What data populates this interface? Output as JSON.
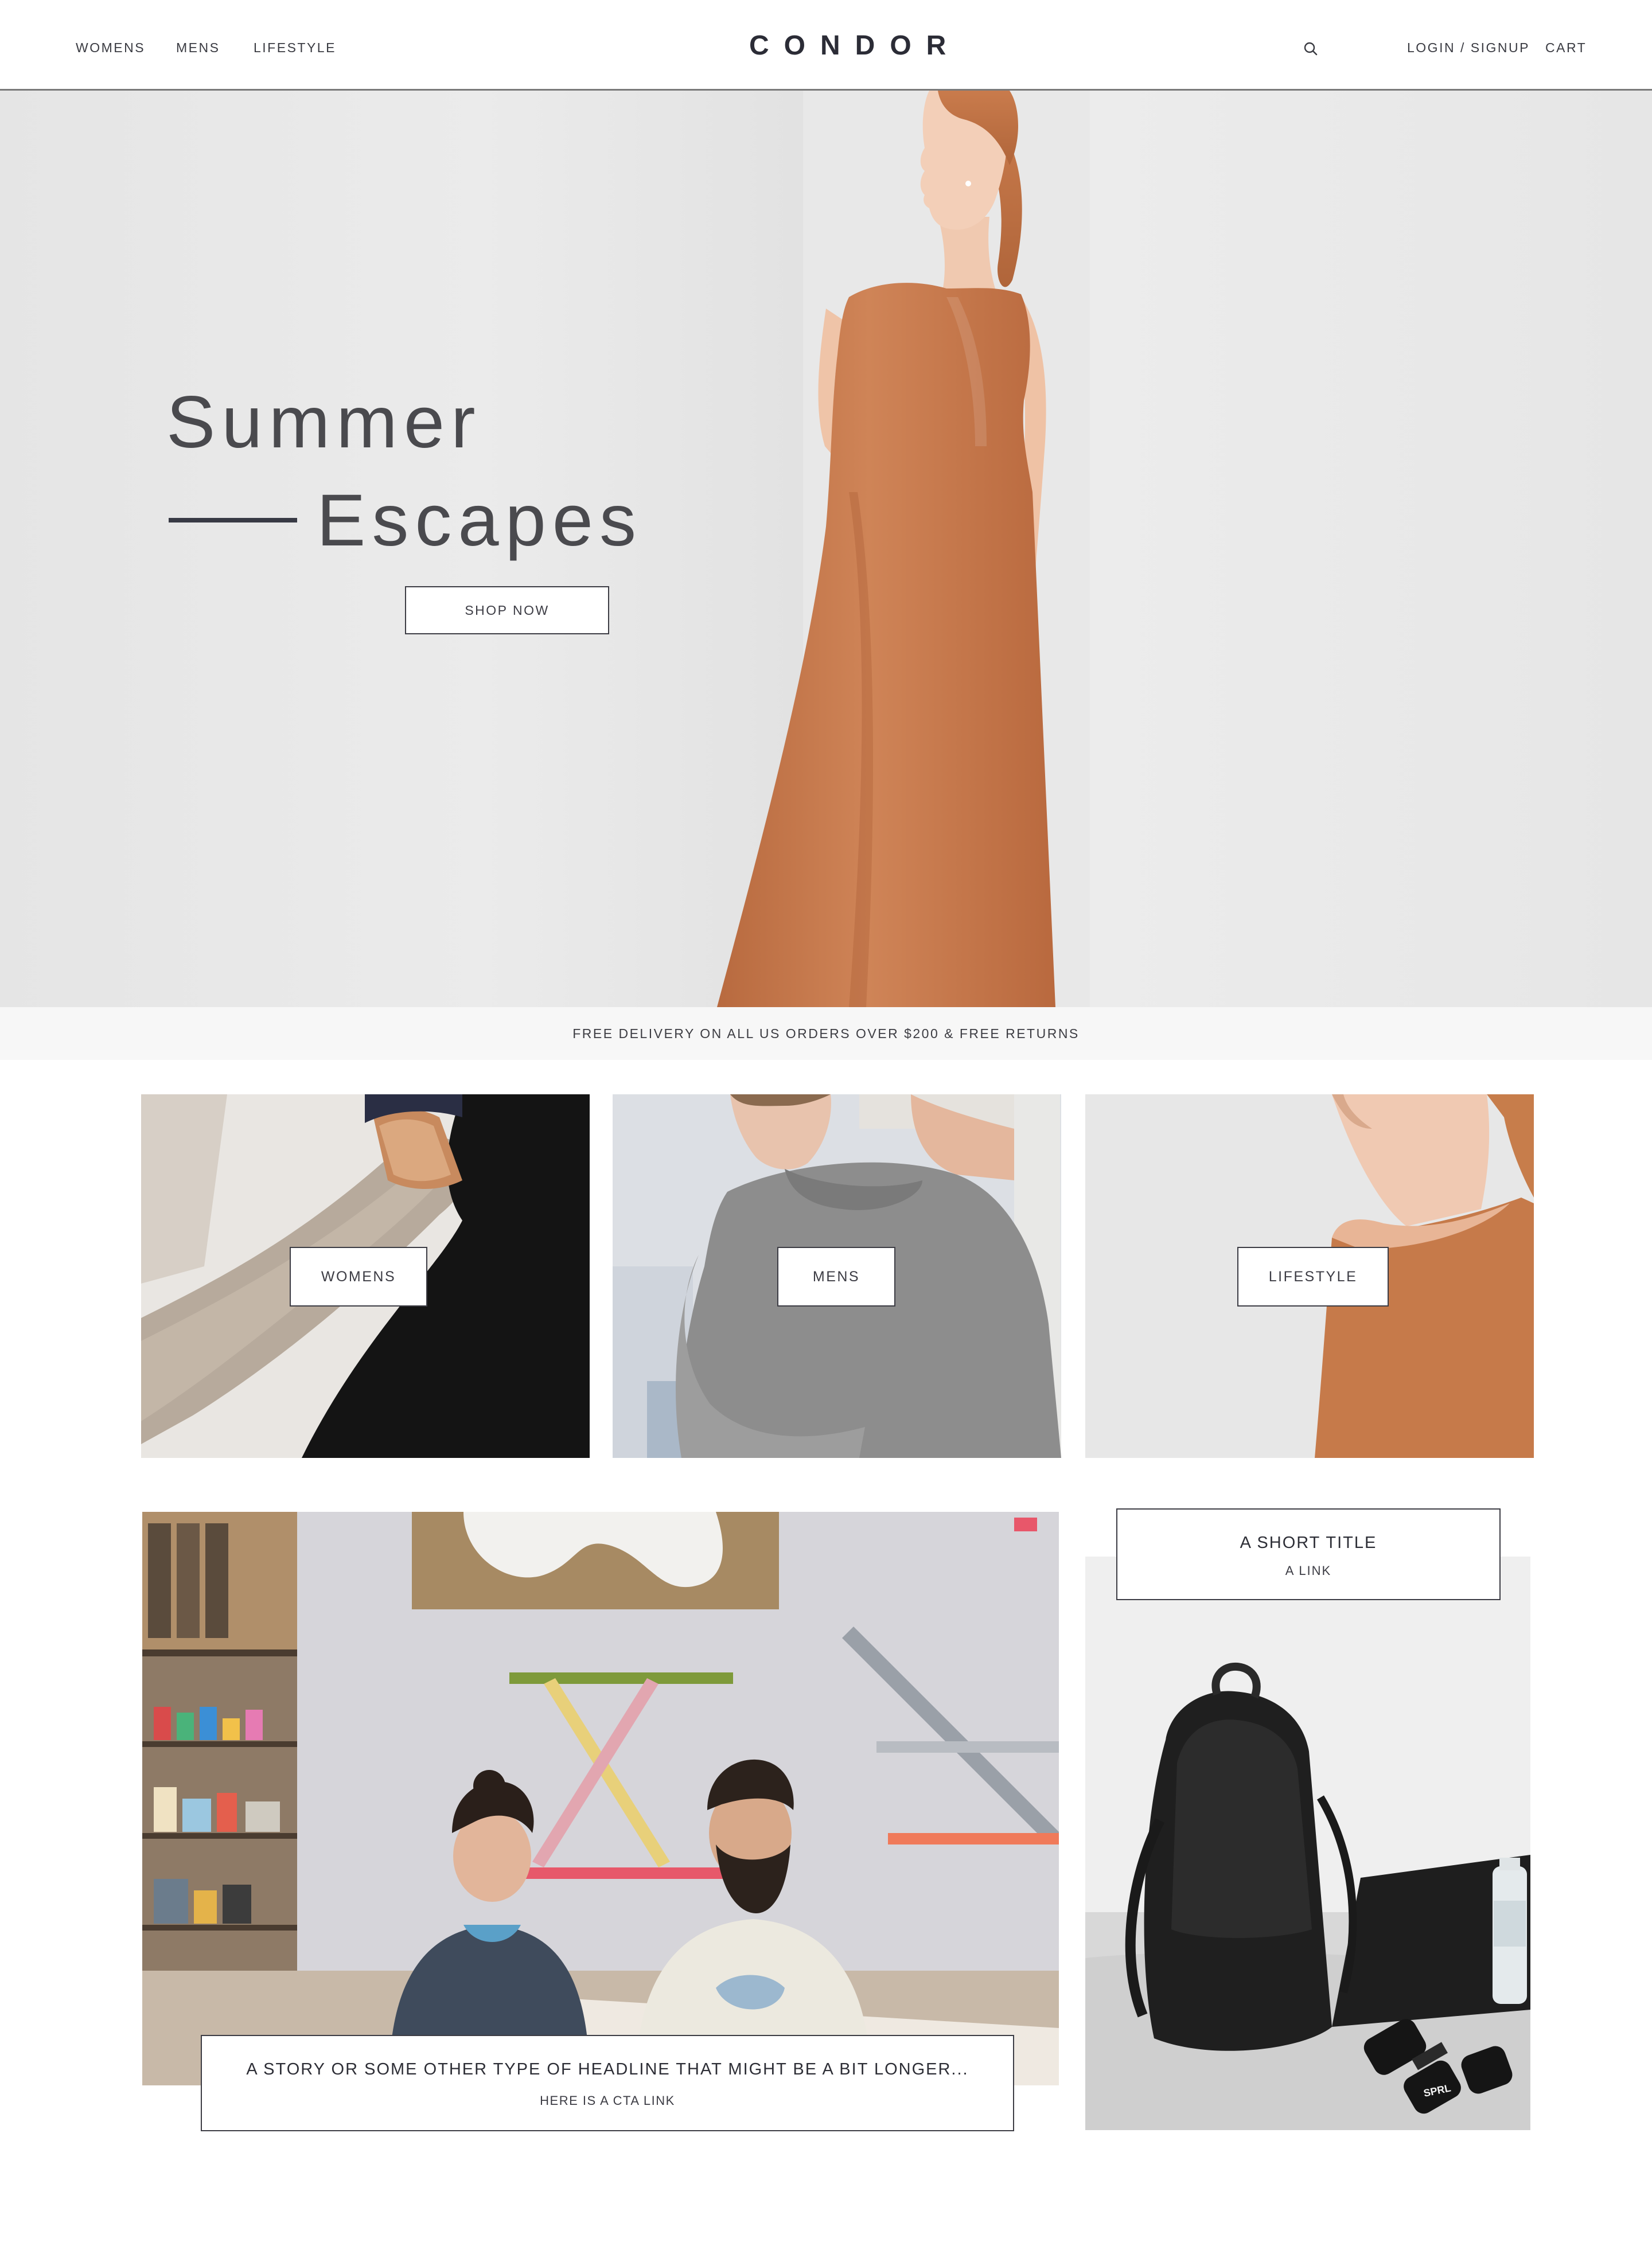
{
  "header": {
    "nav": [
      "WOMENS",
      "MENS",
      "LIFESTYLE"
    ],
    "logo": "CONDOR",
    "login": "LOGIN / SIGNUP",
    "cart": "CART"
  },
  "hero": {
    "title_line1": "Summer",
    "title_line2": "Escapes",
    "cta": "SHOP NOW"
  },
  "promo": "FREE DELIVERY ON ALL US ORDERS OVER $200 & FREE RETURNS",
  "categories": [
    {
      "label": "WOMENS"
    },
    {
      "label": "MENS"
    },
    {
      "label": "LIFESTYLE"
    }
  ],
  "story": {
    "headline": "A STORY OR SOME OTHER TYPE OF HEADLINE THAT MIGHT BE A BIT LONGER...",
    "cta": "HERE IS A CTA LINK"
  },
  "feature": {
    "title": "A SHORT TITLE",
    "link": "A LINK",
    "product_mark": "SPRL"
  },
  "colors": {
    "text": "#2b2c33",
    "accent_rule": "#383a45",
    "dress": "#c67b4f",
    "hero_bg": "#e8e8e8"
  }
}
